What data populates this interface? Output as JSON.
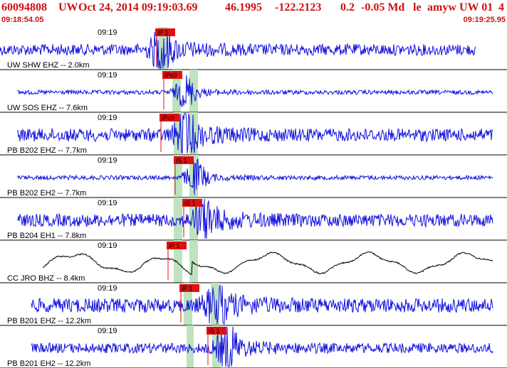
{
  "header": {
    "event_id": "60094808",
    "network": "UW",
    "datetime": "Oct 24, 2014 09:19:03.69",
    "lat": "46.1995",
    "lon": "-122.2123",
    "depth": "0.2",
    "magnitude": "-0.05 Md",
    "flags": "le",
    "author": "amyw",
    "source": "UW 01",
    "version": "4"
  },
  "time_window": {
    "start": "09:18:54.05",
    "end": "09:19:25.95"
  },
  "colors": {
    "trace": "#1010e0",
    "lp_trace": "#000000",
    "pick": "#e01010",
    "window": "#bfe3bf",
    "title": "#d01010"
  },
  "channels": [
    {
      "label": "UW SHW EHZ -- 2.0km",
      "time_label": "09:19",
      "pick": "iP 1"
    },
    {
      "label": "UW SOS EHZ -- 7.6km",
      "time_label": "09:19",
      "pick": "iPc0"
    },
    {
      "label": "PB B202 EHZ -- 7.7km",
      "time_label": "09:19",
      "pick": "iPc0"
    },
    {
      "label": "PB B202 EH2 -- 7.7km",
      "time_label": "09:19",
      "pick": "iS 1"
    },
    {
      "label": "PB B204 EH1 -- 7.8km",
      "time_label": "09:19",
      "pick": "iS 1"
    },
    {
      "label": "CC JRO BHZ -- 8.4km",
      "time_label": "09:19",
      "pick": "iP 1"
    },
    {
      "label": "PB B201 EHZ -- 12.2km",
      "time_label": "09:19",
      "pick": "iP 1"
    },
    {
      "label": "PB B201 EH2 -- 12.2km",
      "time_label": "09:19",
      "pick": "iS 1"
    }
  ]
}
